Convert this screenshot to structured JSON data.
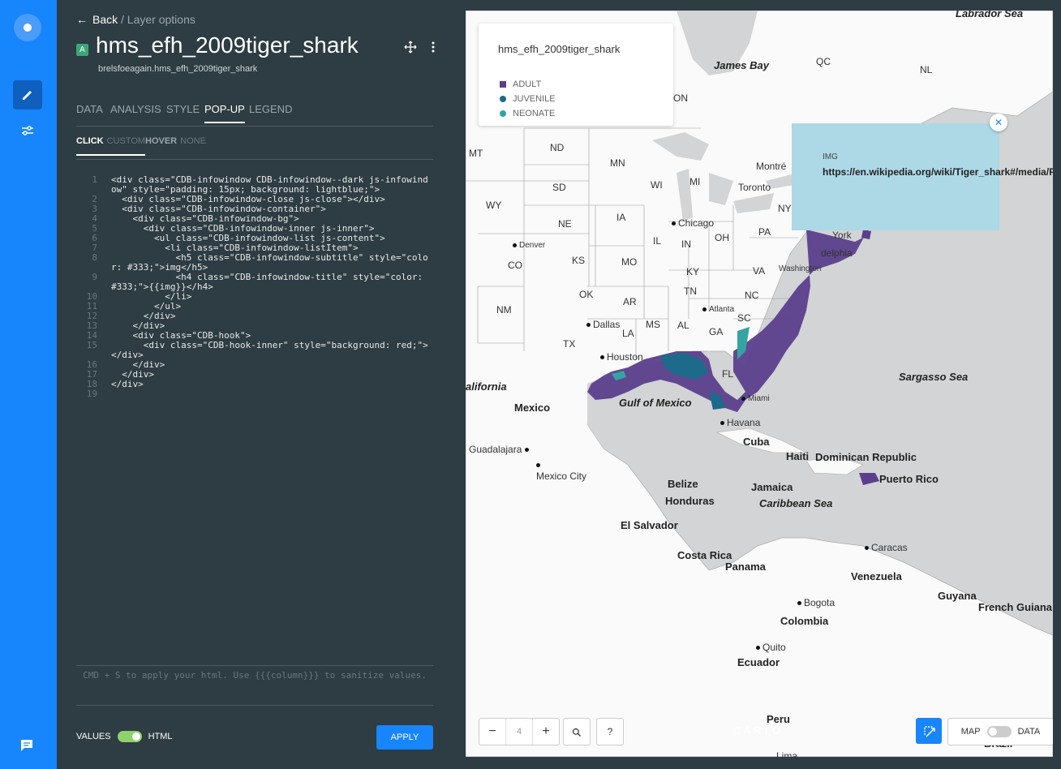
{
  "rail": {
    "items": [
      {
        "icon": "pencil-icon",
        "active": true
      },
      {
        "icon": "sliders-icon",
        "active": false
      }
    ],
    "bottom_icon": "chat-icon"
  },
  "header": {
    "back_label": "Back",
    "breadcrumb": "/ Layer options",
    "layer_letter": "A",
    "layer_name": "hms_efh_2009tiger_shark",
    "layer_source": "brelsfoeagain.hms_efh_2009tiger_shark"
  },
  "tabs": [
    "DATA",
    "ANALYSIS",
    "STYLE",
    "POP-UP",
    "LEGEND"
  ],
  "active_tab": "POP-UP",
  "subtabs": {
    "click": {
      "label": "CLICK",
      "option": "CUSTOM"
    },
    "hover": {
      "label": "HOVER",
      "option": "NONE"
    }
  },
  "code_lines": [
    {
      "n": "1",
      "text": "<div class=\"CDB-infowindow CDB-infowindow--dark js-infowindow\" style=\"padding: 15px; background: lightblue;\">"
    },
    {
      "n": "2",
      "text": "  <div class=\"CDB-infowindow-close js-close\"></div>"
    },
    {
      "n": "3",
      "text": "  <div class=\"CDB-infowindow-container\">"
    },
    {
      "n": "4",
      "text": "    <div class=\"CDB-infowindow-bg\">"
    },
    {
      "n": "5",
      "text": "      <div class=\"CDB-infowindow-inner js-inner\">"
    },
    {
      "n": "6",
      "text": "        <ul class=\"CDB-infowindow-list js-content\">"
    },
    {
      "n": "7",
      "text": "          <li class=\"CDB-infowindow-listItem\">"
    },
    {
      "n": "8",
      "text": "            <h5 class=\"CDB-infowindow-subtitle\" style=\"color: #333;\">img</h5>"
    },
    {
      "n": "9",
      "text": "            <h4 class=\"CDB-infowindow-title\" style=\"color: #333;\">{{img}}</h4>"
    },
    {
      "n": "10",
      "text": "          </li>"
    },
    {
      "n": "11",
      "text": "        </ul>"
    },
    {
      "n": "12",
      "text": "      </div>"
    },
    {
      "n": "13",
      "text": "    </div>"
    },
    {
      "n": "14",
      "text": "    <div class=\"CDB-hook\">"
    },
    {
      "n": "15",
      "text": "      <div class=\"CDB-hook-inner\" style=\"background: red;\"></div>"
    },
    {
      "n": "16",
      "text": "    </div>"
    },
    {
      "n": "17",
      "text": "  </div>"
    },
    {
      "n": "18",
      "text": "</div>"
    },
    {
      "n": "19",
      "text": ""
    }
  ],
  "hint": "CMD + S to apply your html. Use {{{column}}} to sanitize values.",
  "toggle": {
    "left": "VALUES",
    "right": "HTML",
    "on": true
  },
  "apply_label": "APPLY",
  "legend": {
    "title": "hms_efh_2009tiger_shark",
    "items": [
      {
        "label": "ADULT",
        "color": "#5b3f8c",
        "shape": "square"
      },
      {
        "label": "JUVENILE",
        "color": "#1d6a8a",
        "shape": "circle"
      },
      {
        "label": "NEONATE",
        "color": "#36a3a3",
        "shape": "circle"
      }
    ]
  },
  "popup": {
    "subtitle": "IMG",
    "title": "https://en.wikipedia.org/wiki/Tiger_shark#/media/File:Tiger_shark.jpg"
  },
  "map_labels": {
    "labrador_sea": "Labrador Sea",
    "james_bay": "James Bay",
    "qc": "QC",
    "nl": "NL",
    "on": "ON",
    "mt": "MT",
    "nd": "ND",
    "mn": "MN",
    "wi": "WI",
    "mi": "MI",
    "montreal": "Montré",
    "toronto": "Toronto",
    "ny": "NY",
    "wy": "WY",
    "sd": "SD",
    "ia": "IA",
    "chicago": "Chicago",
    "pa": "PA",
    "ne": "NE",
    "il": "IL",
    "in": "IN",
    "oh": "OH",
    "denver": "Denver",
    "co": "CO",
    "ks": "KS",
    "mo": "MO",
    "ky": "KY",
    "va": "VA",
    "washington": "Washington",
    "new_york": "York",
    "philadelphia": "delphia",
    "tn": "TN",
    "nc": "NC",
    "ok": "OK",
    "ar": "AR",
    "nm": "NM",
    "atlanta": "Atlanta",
    "sc": "SC",
    "dallas": "Dallas",
    "tx": "TX",
    "la": "LA",
    "ms": "MS",
    "al": "AL",
    "ga": "GA",
    "houston": "Houston",
    "fl": "FL",
    "miami": "Miami",
    "california": "alifornia",
    "gulf_of_mexico": "Gulf of Mexico",
    "mexico": "Mexico",
    "havana": "Havana",
    "cuba": "Cuba",
    "sargasso_sea": "Sargasso Sea",
    "guadalajara": "Guadalajara",
    "mexico_city": "Mexico City",
    "haiti": "Haiti",
    "dominican_republic": "Dominican Republic",
    "puerto_rico": "Puerto Rico",
    "belize": "Belize",
    "honduras": "Honduras",
    "jamaica": "Jamaica",
    "caribbean_sea": "Caribbean Sea",
    "el_salvador": "El Salvador",
    "caracas": "Caracas",
    "costa_rica": "Costa Rica",
    "panama": "Panama",
    "venezuela": "Venezuela",
    "guyana": "Guyana",
    "french_guiana": "French Guiana",
    "bogota": "Bogota",
    "colombia": "Colombia",
    "quito": "Quito",
    "ecuador": "Ecuador",
    "peru": "Peru",
    "brazil": "Brazil",
    "lima": "Lima"
  },
  "map_controls": {
    "zoom_level": "4",
    "zoom_out": "−",
    "zoom_in": "+",
    "help": "?",
    "attribution": "CARTO",
    "map_label": "MAP",
    "data_label": "DATA"
  }
}
